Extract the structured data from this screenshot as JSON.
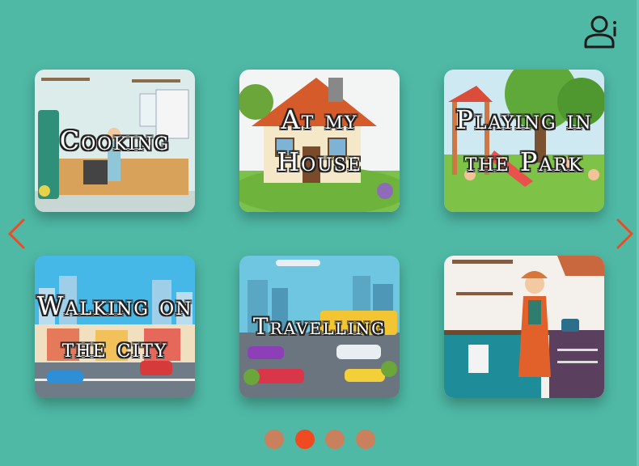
{
  "header": {
    "user_icon": "user-info-icon"
  },
  "nav": {
    "prev_icon": "chevron-left-icon",
    "next_icon": "chevron-right-icon"
  },
  "cards": [
    {
      "title": "Cooking"
    },
    {
      "title": "At my\nHouse"
    },
    {
      "title": "Playing in\nthe Park"
    },
    {
      "title": "Walking on\nthe city"
    },
    {
      "title": "Travelling"
    },
    {
      "title": ""
    }
  ],
  "pagination": {
    "count": 4,
    "active": 2
  },
  "colors": {
    "background": "#4fb9a6",
    "arrow": "#f04a22",
    "dot": "#c9805c",
    "dot_active": "#f04a22"
  }
}
